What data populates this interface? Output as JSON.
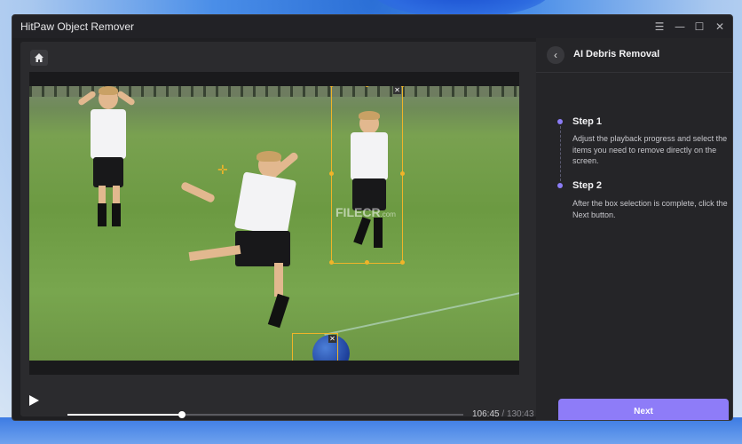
{
  "window": {
    "title": "HitPaw Object Remover"
  },
  "titlebar": {
    "menu_icon": "menu-icon",
    "minimize_icon": "minimize-icon",
    "maximize_icon": "maximize-icon",
    "close_icon": "close-icon"
  },
  "player": {
    "current_time": "106:45",
    "separator": "/",
    "total_time": "130:43",
    "progress": 0.29,
    "watermark": "FILECR",
    "watermark_suffix": ".com"
  },
  "panel": {
    "title": "AI Debris Removal",
    "steps": [
      {
        "label": "Step 1",
        "text": "Adjust the playback progress and select the items you need to remove directly on the screen."
      },
      {
        "label": "Step 2",
        "text": "After the box selection is complete, click the Next button."
      }
    ],
    "next_label": "Next"
  },
  "colors": {
    "accent": "#8e7cf8",
    "selection": "#f0b429",
    "window_bg": "#1f1f22"
  }
}
